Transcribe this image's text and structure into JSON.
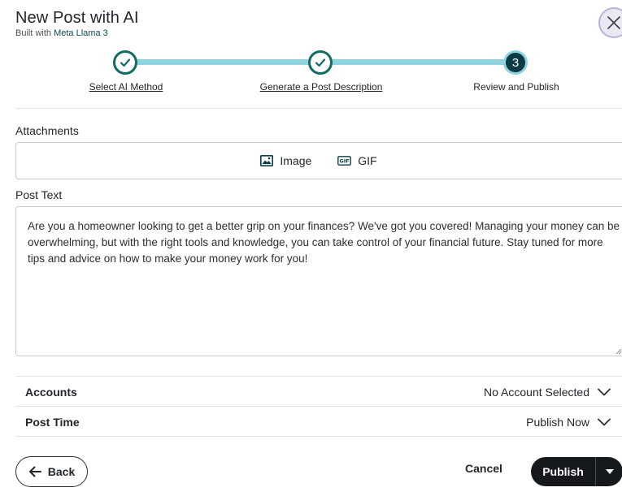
{
  "header": {
    "title": "New Post with AI",
    "subtitle_prefix": "Built with",
    "subtitle_brand": "Meta Llama 3",
    "close_icon": "close-icon"
  },
  "stepper": {
    "steps": [
      {
        "label": "Select AI Method",
        "state": "done"
      },
      {
        "label": "Generate a Post Description",
        "state": "done"
      },
      {
        "label": "Review and Publish",
        "state": "current",
        "number": "3"
      }
    ]
  },
  "attachments": {
    "label": "Attachments",
    "image_label": "Image",
    "gif_label": "GIF",
    "gif_icon_text": "GIF"
  },
  "post_text": {
    "label": "Post Text",
    "value": "Are you a homeowner looking to get a better grip on your finances? We've got you covered! Managing your money can be overwhelming, but with the right tools and knowledge, you can take control of your financial future. Stay tuned for more tips and advice on how to make your money work for you!"
  },
  "accounts": {
    "label": "Accounts",
    "value": "No Account Selected"
  },
  "post_time": {
    "label": "Post Time",
    "value": "Publish Now"
  },
  "footer": {
    "back_label": "Back",
    "cancel_label": "Cancel",
    "publish_label": "Publish"
  },
  "colors": {
    "accent_dark": "#0d3b45",
    "track": "#8fd3df",
    "check": "#0f6b64",
    "primary_button": "#16191c"
  }
}
